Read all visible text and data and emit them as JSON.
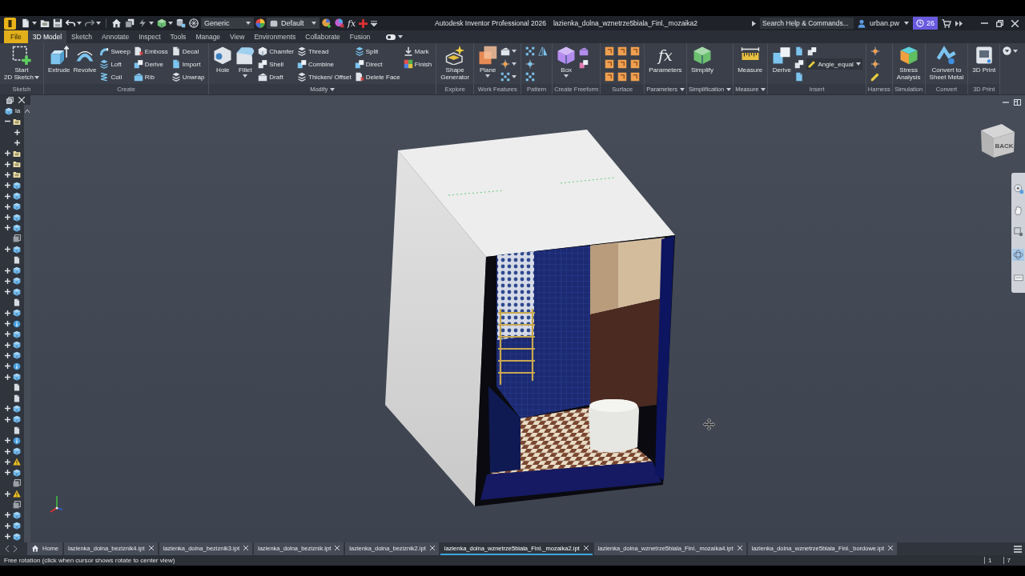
{
  "title_bar": {
    "material": "Generic",
    "appearance": "Default",
    "formula_glyph": "fx",
    "app_title": "Autodesk Inventor Professional 2026",
    "document": "lazienka_dolna_wznetrze5biala_Finl._mozaika2",
    "search": {
      "placeholder": "Search Help & Commands..."
    },
    "user": "urban.pw",
    "notification_count": "26"
  },
  "ribbon_tabs": [
    {
      "label": "File",
      "kind": "menu",
      "selected": false
    },
    {
      "label": "3D Model",
      "kind": "tab",
      "selected": true
    },
    {
      "label": "Sketch",
      "kind": "tab",
      "selected": false
    },
    {
      "label": "Annotate",
      "kind": "tab",
      "selected": false
    },
    {
      "label": "Inspect",
      "kind": "tab",
      "selected": false
    },
    {
      "label": "Tools",
      "kind": "tab",
      "selected": false
    },
    {
      "label": "Manage",
      "kind": "tab",
      "selected": false
    },
    {
      "label": "View",
      "kind": "tab",
      "selected": false
    },
    {
      "label": "Environments",
      "kind": "tab",
      "selected": false
    },
    {
      "label": "Collaborate",
      "kind": "tab",
      "selected": false
    },
    {
      "label": "Fusion",
      "kind": "tab",
      "selected": false
    }
  ],
  "ribbon_panels": [
    {
      "label": "Sketch",
      "menu": false,
      "columns": [
        [
          {
            "kind": "large",
            "lines": [
              "Start",
              "2D Sketch"
            ],
            "caret": true
          }
        ]
      ]
    },
    {
      "label": "Create",
      "menu": false,
      "columns": [
        [
          {
            "kind": "large",
            "lines": [
              "Extrude"
            ],
            "caret": false
          }
        ],
        [
          {
            "kind": "large",
            "lines": [
              "Revolve"
            ],
            "caret": false
          }
        ],
        [
          {
            "kind": "small",
            "label": "Sweep"
          },
          {
            "kind": "small",
            "label": "Loft"
          },
          {
            "kind": "small",
            "label": "Coil"
          }
        ],
        [
          {
            "kind": "small",
            "label": "Emboss"
          },
          {
            "kind": "small",
            "label": "Derive"
          },
          {
            "kind": "small",
            "label": "Rib"
          }
        ],
        [
          {
            "kind": "small",
            "label": "Decal"
          },
          {
            "kind": "small",
            "label": "Import"
          },
          {
            "kind": "small",
            "label": "Unwrap"
          }
        ]
      ]
    },
    {
      "label": "Modify",
      "menu": true,
      "columns": [
        [
          {
            "kind": "large",
            "lines": [
              "Hole"
            ],
            "caret": false
          }
        ],
        [
          {
            "kind": "large",
            "lines": [
              "Fillet"
            ],
            "caret": true
          }
        ],
        [
          {
            "kind": "small",
            "label": "Chamfer"
          },
          {
            "kind": "small",
            "label": "Shell"
          },
          {
            "kind": "small",
            "label": "Draft"
          }
        ],
        [
          {
            "kind": "small",
            "label": "Thread"
          },
          {
            "kind": "small",
            "label": "Combine"
          },
          {
            "kind": "small",
            "label": "Thicken/ Offset"
          }
        ],
        [
          {
            "kind": "small",
            "label": "Split"
          },
          {
            "kind": "small",
            "label": "Direct"
          },
          {
            "kind": "small",
            "label": "Delete Face"
          }
        ],
        [
          {
            "kind": "small",
            "label": "Mark"
          },
          {
            "kind": "small",
            "label": "Finish"
          }
        ]
      ]
    },
    {
      "label": "Explore",
      "menu": false,
      "columns": [
        [
          {
            "kind": "large",
            "lines": [
              "Shape",
              "Generator"
            ],
            "caret": false
          }
        ]
      ]
    },
    {
      "label": "Work Features",
      "menu": false,
      "columns": [
        [
          {
            "kind": "large",
            "lines": [
              "Plane"
            ],
            "caret": true
          }
        ],
        [
          {
            "kind": "icon",
            "caret": true
          },
          {
            "kind": "icon",
            "caret": true
          },
          {
            "kind": "icon",
            "caret": true
          }
        ]
      ]
    },
    {
      "label": "Pattern",
      "menu": false,
      "columns": [
        [
          {
            "kind": "icon",
            "caret": false
          },
          {
            "kind": "icon",
            "caret": false
          },
          {
            "kind": "icon",
            "caret": false
          }
        ],
        [
          {
            "kind": "icon",
            "caret": false
          }
        ]
      ]
    },
    {
      "label": "Create Freeform",
      "menu": false,
      "columns": [
        [
          {
            "kind": "large",
            "lines": [
              "Box"
            ],
            "caret": true
          }
        ],
        [
          {
            "kind": "icon",
            "caret": false
          },
          {
            "kind": "icon",
            "caret": false
          }
        ]
      ]
    },
    {
      "label": "Surface",
      "menu": false,
      "columns": [
        [
          {
            "kind": "icon",
            "caret": false
          },
          {
            "kind": "icon",
            "caret": false
          },
          {
            "kind": "icon",
            "caret": false
          }
        ],
        [
          {
            "kind": "icon",
            "caret": false
          },
          {
            "kind": "icon",
            "caret": false
          },
          {
            "kind": "icon",
            "caret": false
          }
        ],
        [
          {
            "kind": "icon",
            "caret": false
          },
          {
            "kind": "icon",
            "caret": false
          },
          {
            "kind": "icon",
            "caret": false
          }
        ]
      ]
    },
    {
      "label": "Parameters",
      "menu": true,
      "columns": [
        [
          {
            "kind": "large",
            "lines": [
              "Parameters"
            ],
            "caret": false,
            "glyph": "fx"
          }
        ]
      ]
    },
    {
      "label": "Simplification",
      "menu": true,
      "columns": [
        [
          {
            "kind": "large",
            "lines": [
              "Simplify"
            ],
            "caret": false
          }
        ]
      ]
    },
    {
      "label": "Measure",
      "menu": true,
      "columns": [
        [
          {
            "kind": "large",
            "lines": [
              "Measure"
            ],
            "caret": false
          }
        ]
      ]
    },
    {
      "label": "Insert",
      "menu": false,
      "columns": [
        [
          {
            "kind": "large",
            "lines": [
              "Derive"
            ],
            "caret": false
          }
        ],
        [
          {
            "kind": "icon",
            "caret": false
          },
          {
            "kind": "icon",
            "caret": false
          },
          {
            "kind": "icon",
            "caret": false
          }
        ],
        [
          {
            "kind": "icon",
            "caret": false
          },
          {
            "kind": "dropdown",
            "value": "Angle_equal"
          }
        ]
      ]
    },
    {
      "label": "Harness",
      "menu": false,
      "columns": [
        [
          {
            "kind": "icon",
            "caret": false
          },
          {
            "kind": "icon",
            "caret": false
          },
          {
            "kind": "icon",
            "caret": false
          }
        ]
      ]
    },
    {
      "label": "Simulation",
      "menu": false,
      "columns": [
        [
          {
            "kind": "large",
            "lines": [
              "Stress",
              "Analysis"
            ],
            "caret": false
          }
        ]
      ]
    },
    {
      "label": "Convert",
      "menu": false,
      "columns": [
        [
          {
            "kind": "large",
            "lines": [
              "Convert to",
              "Sheet Metal"
            ],
            "caret": false
          }
        ]
      ]
    },
    {
      "label": "3D Print",
      "menu": false,
      "columns": [
        [
          {
            "kind": "large",
            "lines": [
              "3D Print"
            ],
            "caret": false
          }
        ]
      ]
    }
  ],
  "browser": {
    "root": {
      "label": "la",
      "children": [
        {
          "kind": "folder",
          "expandable": true,
          "expanded": true,
          "children": [
            {
              "expandable": true,
              "expanded": false
            },
            {
              "expandable": true,
              "expanded": false
            }
          ]
        },
        {
          "kind": "folder",
          "expandable": true,
          "expanded": false
        },
        {
          "kind": "folder",
          "expandable": true,
          "expanded": false
        },
        {
          "kind": "folder",
          "expandable": true,
          "expanded": false
        },
        {
          "kind": "body",
          "expandable": true,
          "expanded": false
        },
        {
          "kind": "body",
          "expandable": true,
          "expanded": false
        },
        {
          "kind": "body",
          "expandable": true,
          "expanded": false
        },
        {
          "kind": "body",
          "expandable": true,
          "expanded": false
        },
        {
          "kind": "body",
          "expandable": true,
          "expanded": false
        },
        {
          "kind": "feature",
          "expandable": false
        },
        {
          "kind": "body",
          "expandable": true,
          "expanded": false
        },
        {
          "kind": "sketch",
          "expandable": false
        },
        {
          "kind": "body",
          "expandable": true,
          "expanded": false
        },
        {
          "kind": "body",
          "expandable": true,
          "expanded": false
        },
        {
          "kind": "body",
          "expandable": true,
          "expanded": false
        },
        {
          "kind": "sketch",
          "expandable": false
        },
        {
          "kind": "body",
          "expandable": true,
          "expanded": false
        },
        {
          "kind": "info",
          "expandable": true,
          "expanded": false
        },
        {
          "kind": "body",
          "expandable": true,
          "expanded": false
        },
        {
          "kind": "body",
          "expandable": true,
          "expanded": false
        },
        {
          "kind": "body",
          "expandable": true,
          "expanded": false
        },
        {
          "kind": "info",
          "expandable": true,
          "expanded": false
        },
        {
          "kind": "body",
          "expandable": true,
          "expanded": false
        },
        {
          "kind": "sketch",
          "expandable": false
        },
        {
          "kind": "sketch",
          "expandable": false
        },
        {
          "kind": "body",
          "expandable": true,
          "expanded": false
        },
        {
          "kind": "body",
          "expandable": true,
          "expanded": false
        },
        {
          "kind": "sketch",
          "expandable": false
        },
        {
          "kind": "info",
          "expandable": true,
          "expanded": false
        },
        {
          "kind": "body",
          "expandable": true,
          "expanded": false
        },
        {
          "kind": "warning",
          "expandable": true,
          "expanded": false
        },
        {
          "kind": "body",
          "expandable": true,
          "expanded": false
        },
        {
          "kind": "feature",
          "expandable": false
        },
        {
          "kind": "warning",
          "expandable": true,
          "expanded": false
        },
        {
          "kind": "feature",
          "expandable": false
        },
        {
          "kind": "body",
          "expandable": true,
          "expanded": false
        },
        {
          "kind": "body",
          "expandable": true,
          "expanded": false
        },
        {
          "kind": "body",
          "expandable": true,
          "expanded": false
        }
      ]
    }
  },
  "view_cube": {
    "face_label": "BACK"
  },
  "document_tabs": [
    {
      "kind": "home",
      "label": "Home",
      "selected": false
    },
    {
      "kind": "file",
      "label": "lazienka_dolna_beziznik4.ipt",
      "selected": false
    },
    {
      "kind": "file",
      "label": "lazienka_dolna_beziznik3.ipt",
      "selected": false
    },
    {
      "kind": "file",
      "label": "lazienka_dolna_beziznik.ipt",
      "selected": false
    },
    {
      "kind": "file",
      "label": "lazienka_dolna_beziznik2.ipt",
      "selected": false
    },
    {
      "kind": "file",
      "label": "lazienka_dolna_wznetrze5biala_Finl._mozaika2.ipt",
      "selected": true
    },
    {
      "kind": "file",
      "label": "lazienka_dolna_wznetrze5biala_Finl._mozaika4.ipt",
      "selected": false
    },
    {
      "kind": "file",
      "label": "lazienka_dolna_wznetrze5biala_Finl._bordowe.ipt",
      "selected": false
    }
  ],
  "status_bar": {
    "message": "Free rotation (click when cursor shows rotate to center view)",
    "fields": [
      "1",
      "7"
    ]
  }
}
